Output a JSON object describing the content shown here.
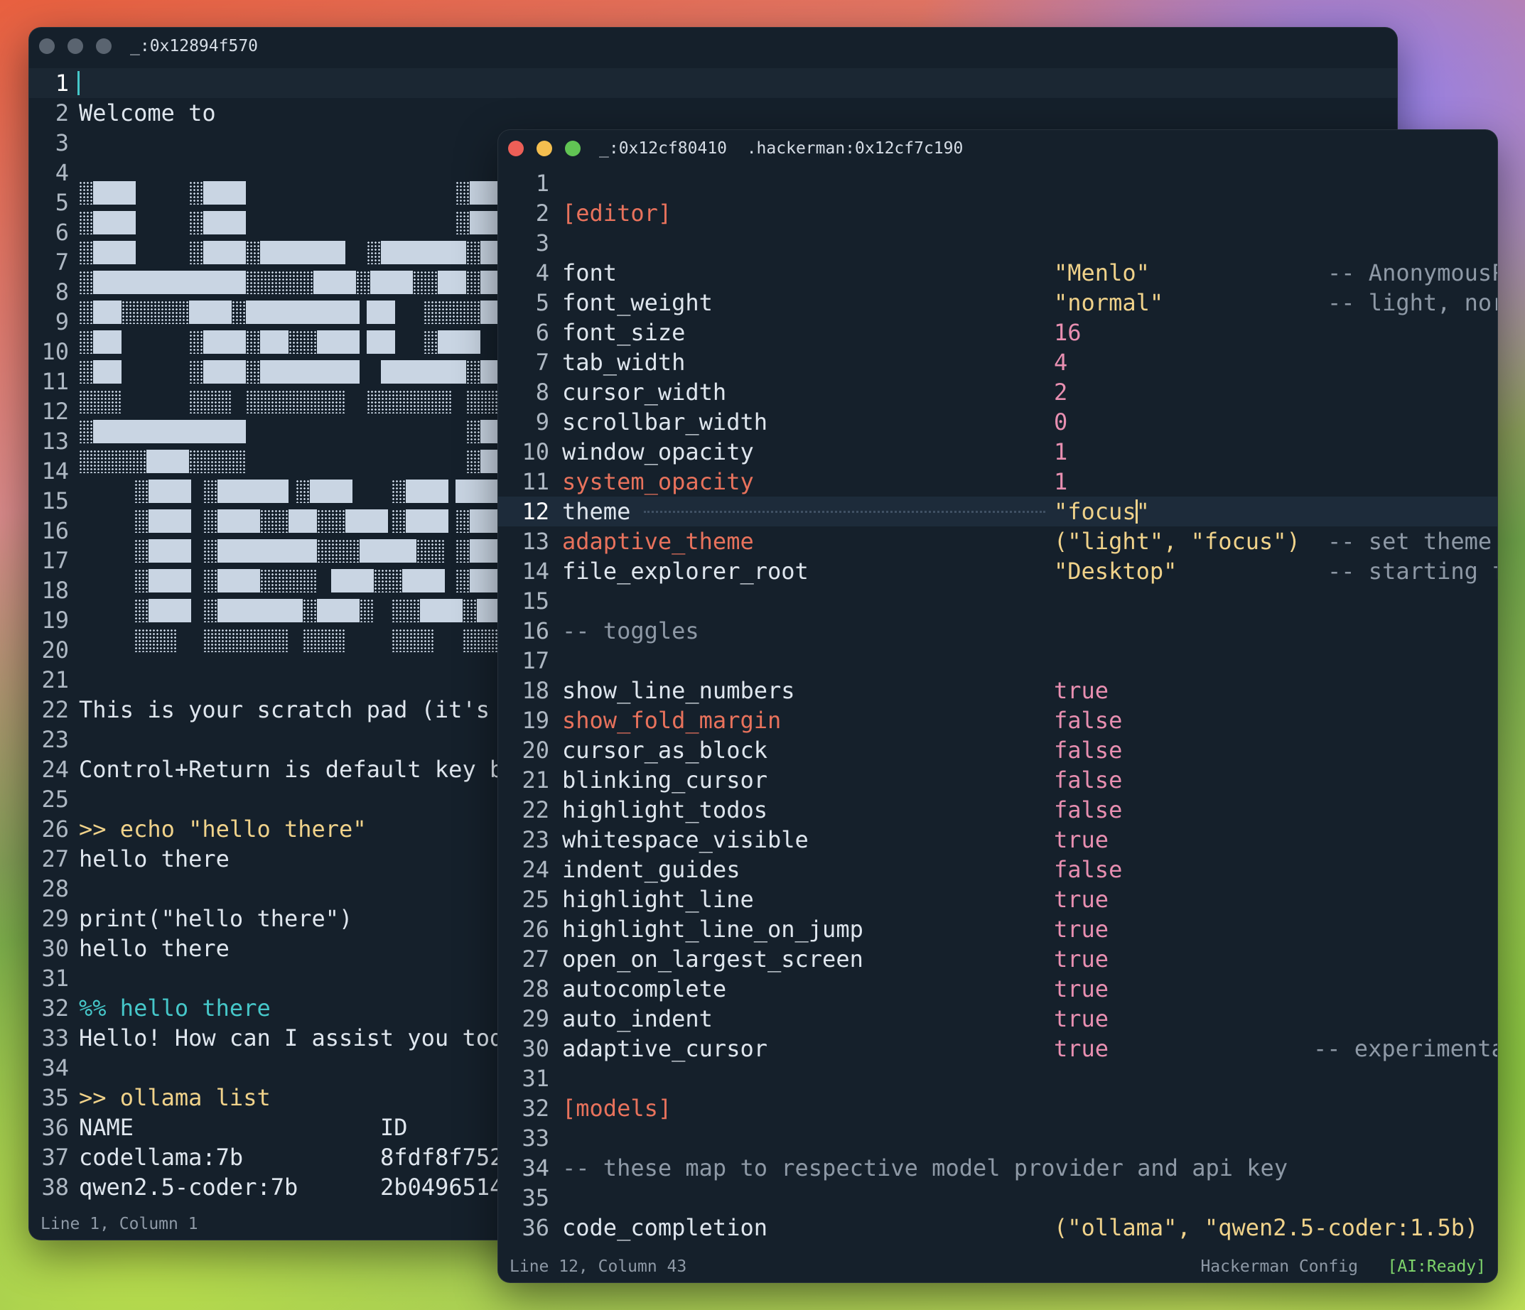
{
  "back_window": {
    "title": "_:0x12894f570",
    "lines": [
      {
        "n": "1",
        "text": ""
      },
      {
        "n": "2",
        "text": "Welcome to"
      },
      {
        "n": "3",
        "text": ""
      },
      {
        "n": "4",
        "text": ""
      },
      {
        "n": "5",
        "text": ""
      },
      {
        "n": "6",
        "text": ""
      },
      {
        "n": "7",
        "text": ""
      },
      {
        "n": "8",
        "text": ""
      },
      {
        "n": "9",
        "text": ""
      },
      {
        "n": "10",
        "text": ""
      },
      {
        "n": "11",
        "text": ""
      },
      {
        "n": "12",
        "text": ""
      },
      {
        "n": "13",
        "text": ""
      },
      {
        "n": "14",
        "text": ""
      },
      {
        "n": "15",
        "text": ""
      },
      {
        "n": "16",
        "text": ""
      },
      {
        "n": "17",
        "text": ""
      },
      {
        "n": "18",
        "text": ""
      },
      {
        "n": "19",
        "text": ""
      },
      {
        "n": "20",
        "text": ""
      },
      {
        "n": "21",
        "text": ""
      },
      {
        "n": "22",
        "text": "This is your scratch pad (it's"
      },
      {
        "n": "23",
        "text": ""
      },
      {
        "n": "24",
        "text": "Control+Return is default key b"
      },
      {
        "n": "25",
        "text": ""
      },
      {
        "n": "26",
        "prompt": ">> ",
        "text": "echo \"hello there\""
      },
      {
        "n": "27",
        "text": "hello there"
      },
      {
        "n": "28",
        "text": ""
      },
      {
        "n": "29",
        "text": "print(\"hello there\")"
      },
      {
        "n": "30",
        "text": "hello there"
      },
      {
        "n": "31",
        "text": ""
      },
      {
        "n": "32",
        "ai": "%% ",
        "text": "hello there"
      },
      {
        "n": "33",
        "text": "Hello! How can I assist you tod"
      },
      {
        "n": "34",
        "text": ""
      },
      {
        "n": "35",
        "prompt": ">> ",
        "text": "ollama list"
      },
      {
        "n": "36",
        "text": "NAME",
        "text2": "ID"
      },
      {
        "n": "37",
        "text": "codellama:7b",
        "text2": "8fdf8f752"
      },
      {
        "n": "38",
        "text": "qwen2.5-coder:7b",
        "text2": "2b0496514"
      }
    ],
    "status": "Line 1, Column 1"
  },
  "front_window": {
    "title": "_:0x12cf80410  .hackerman:0x12cf7c190",
    "lines": [
      {
        "n": "1",
        "key": "",
        "val": "",
        "comment": ""
      },
      {
        "n": "2",
        "key": "[editor]",
        "kc": "section",
        "val": "",
        "comment": ""
      },
      {
        "n": "3",
        "key": "",
        "val": "",
        "comment": ""
      },
      {
        "n": "4",
        "key": "font",
        "val": "\"Menlo\"",
        "vc": "str",
        "comment": "-- AnonymousP"
      },
      {
        "n": "5",
        "key": "font_weight",
        "val": "\"normal\"",
        "vc": "str",
        "comment": "-- light, nor"
      },
      {
        "n": "6",
        "key": "font_size",
        "val": "16",
        "vc": "num",
        "comment": ""
      },
      {
        "n": "7",
        "key": "tab_width",
        "val": "4",
        "vc": "num",
        "comment": ""
      },
      {
        "n": "8",
        "key": "cursor_width",
        "val": "2",
        "vc": "num",
        "comment": ""
      },
      {
        "n": "9",
        "key": "scrollbar_width",
        "val": "0",
        "vc": "num",
        "comment": ""
      },
      {
        "n": "10",
        "key": "window_opacity",
        "val": "1",
        "vc": "num",
        "comment": ""
      },
      {
        "n": "11",
        "key": "system_opacity",
        "kc": "red",
        "val": "1",
        "vc": "num",
        "comment": ""
      },
      {
        "n": "12",
        "key": "theme",
        "val": "\"focus\"",
        "vc": "str",
        "comment": "",
        "current": true
      },
      {
        "n": "13",
        "key": "adaptive_theme",
        "kc": "red",
        "val": "(\"light\", \"focus\")",
        "vc": "tuple",
        "comment": "-- set theme"
      },
      {
        "n": "14",
        "key": "file_explorer_root",
        "val": "\"Desktop\"",
        "vc": "str",
        "comment": "-- starting f"
      },
      {
        "n": "15",
        "key": "",
        "val": "",
        "comment": ""
      },
      {
        "n": "16",
        "key": "-- toggles",
        "kc": "comment",
        "val": "",
        "comment": ""
      },
      {
        "n": "17",
        "key": "",
        "val": "",
        "comment": ""
      },
      {
        "n": "18",
        "key": "show_line_numbers",
        "val": "true",
        "vc": "bool",
        "comment": ""
      },
      {
        "n": "19",
        "key": "show_fold_margin",
        "kc": "red",
        "val": "false",
        "vc": "bool",
        "comment": ""
      },
      {
        "n": "20",
        "key": "cursor_as_block",
        "val": "false",
        "vc": "bool",
        "comment": ""
      },
      {
        "n": "21",
        "key": "blinking_cursor",
        "val": "false",
        "vc": "bool",
        "comment": ""
      },
      {
        "n": "22",
        "key": "highlight_todos",
        "val": "false",
        "vc": "bool",
        "comment": ""
      },
      {
        "n": "23",
        "key": "whitespace_visible",
        "val": "true",
        "vc": "bool",
        "comment": ""
      },
      {
        "n": "24",
        "key": "indent_guides",
        "val": "false",
        "vc": "bool",
        "comment": ""
      },
      {
        "n": "25",
        "key": "highlight_line",
        "val": "true",
        "vc": "bool",
        "comment": ""
      },
      {
        "n": "26",
        "key": "highlight_line_on_jump",
        "val": "true",
        "vc": "bool",
        "comment": ""
      },
      {
        "n": "27",
        "key": "open_on_largest_screen",
        "val": "true",
        "vc": "bool",
        "comment": ""
      },
      {
        "n": "28",
        "key": "autocomplete",
        "val": "true",
        "vc": "bool",
        "comment": ""
      },
      {
        "n": "29",
        "key": "auto_indent",
        "val": "true",
        "vc": "bool",
        "comment": ""
      },
      {
        "n": "30",
        "key": "adaptive_cursor",
        "val": "true",
        "vc": "bool",
        "comment": "-- experimenta"
      },
      {
        "n": "31",
        "key": "",
        "val": "",
        "comment": ""
      },
      {
        "n": "32",
        "key": "[models]",
        "kc": "section",
        "val": "",
        "comment": ""
      },
      {
        "n": "33",
        "key": "",
        "val": "",
        "comment": ""
      },
      {
        "n": "34",
        "key": "-- these map to respective model provider and api key",
        "kc": "comment",
        "val": "",
        "comment": ""
      },
      {
        "n": "35",
        "key": "",
        "val": "",
        "comment": ""
      },
      {
        "n": "36",
        "key": "code_completion",
        "val": "(\"ollama\", \"qwen2.5-coder:1.5b)",
        "vc": "tuple",
        "comment": ""
      }
    ],
    "status_left": "Line 12, Column 43",
    "status_mid": "Hackerman Config",
    "status_right": "[AI:Ready]"
  },
  "colors": {
    "background": "#15202b",
    "text": "#dfe6ee",
    "section_red": "#e8725c",
    "string_yellow": "#f0d28a",
    "number_pink": "#e88fb1",
    "bool_pink": "#e88fb1",
    "comment_gray": "#8e99a6",
    "ai_cyan": "#46c7c9",
    "prompt_yellow": "#f0d28a",
    "status_green": "#7ed46b",
    "current_line": "#1d2b3a"
  }
}
